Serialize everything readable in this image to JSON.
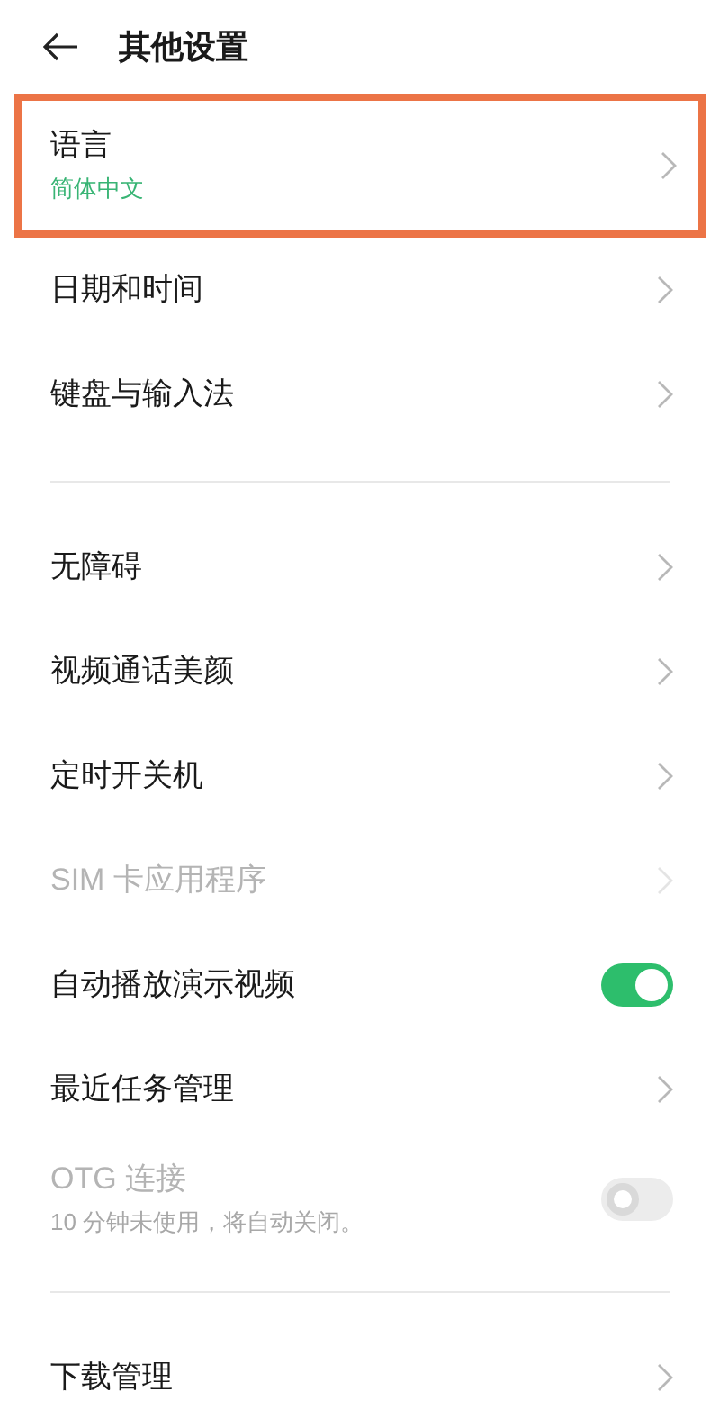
{
  "header": {
    "title": "其他设置"
  },
  "groups": [
    {
      "items": [
        {
          "kind": "arrow",
          "label": "语言",
          "subtitle": "简体中文",
          "highlighted": true,
          "disabled": false
        },
        {
          "kind": "arrow",
          "label": "日期和时间",
          "highlighted": false,
          "disabled": false
        },
        {
          "kind": "arrow",
          "label": "键盘与输入法",
          "highlighted": false,
          "disabled": false
        }
      ]
    },
    {
      "items": [
        {
          "kind": "arrow",
          "label": "无障碍",
          "highlighted": false,
          "disabled": false
        },
        {
          "kind": "arrow",
          "label": "视频通话美颜",
          "highlighted": false,
          "disabled": false
        },
        {
          "kind": "arrow",
          "label": "定时开关机",
          "highlighted": false,
          "disabled": false
        },
        {
          "kind": "arrow",
          "label": "SIM 卡应用程序",
          "highlighted": false,
          "disabled": true
        },
        {
          "kind": "switch",
          "label": "自动播放演示视频",
          "on": true,
          "highlighted": false,
          "disabled": false
        },
        {
          "kind": "arrow",
          "label": "最近任务管理",
          "highlighted": false,
          "disabled": false
        },
        {
          "kind": "switch",
          "label": "OTG 连接",
          "subtitle": "10 分钟未使用，将自动关闭。",
          "on": false,
          "highlighted": false,
          "disabled": true
        }
      ]
    },
    {
      "items": [
        {
          "kind": "arrow",
          "label": "下载管理",
          "highlighted": false,
          "disabled": false
        }
      ]
    }
  ]
}
